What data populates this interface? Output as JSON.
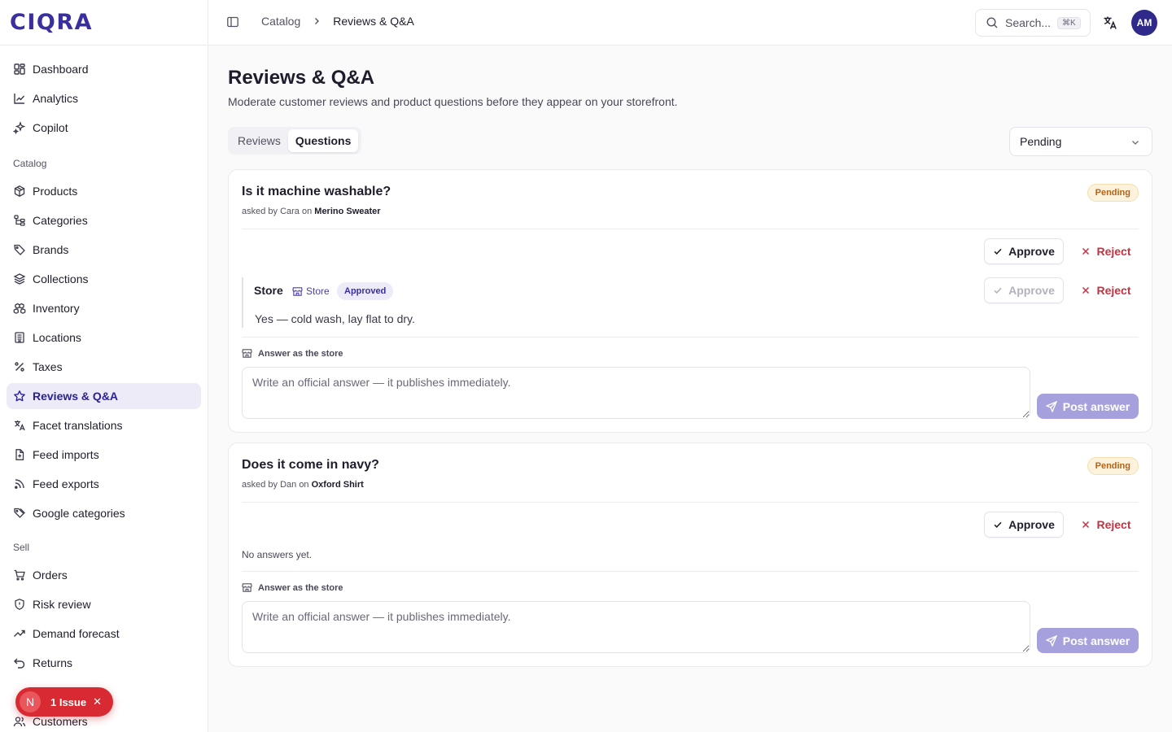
{
  "brand": {
    "logo_text": "CIQRA"
  },
  "sidebar": {
    "top_items": [
      {
        "label": "Dashboard",
        "icon": "dashboard-icon"
      },
      {
        "label": "Analytics",
        "icon": "analytics-icon"
      },
      {
        "label": "Copilot",
        "icon": "sparkles-icon"
      }
    ],
    "catalog_group": "Catalog",
    "catalog_items": [
      {
        "label": "Products",
        "icon": "package-icon"
      },
      {
        "label": "Categories",
        "icon": "tree-icon"
      },
      {
        "label": "Brands",
        "icon": "tag-icon"
      },
      {
        "label": "Collections",
        "icon": "layers-icon"
      },
      {
        "label": "Inventory",
        "icon": "boxes-icon"
      },
      {
        "label": "Locations",
        "icon": "building-icon"
      },
      {
        "label": "Taxes",
        "icon": "percent-icon"
      },
      {
        "label": "Reviews & Q&A",
        "icon": "star-icon",
        "active": true
      },
      {
        "label": "Facet translations",
        "icon": "translate-icon"
      },
      {
        "label": "Feed imports",
        "icon": "file-import-icon"
      },
      {
        "label": "Feed exports",
        "icon": "rss-icon"
      },
      {
        "label": "Google categories",
        "icon": "tags-icon"
      }
    ],
    "sell_group": "Sell",
    "sell_items": [
      {
        "label": "Orders",
        "icon": "cart-icon"
      },
      {
        "label": "Risk review",
        "icon": "shield-icon"
      },
      {
        "label": "Demand forecast",
        "icon": "trending-icon"
      },
      {
        "label": "Returns",
        "icon": "undo-icon"
      },
      {
        "label": "",
        "icon": "hidden-icon"
      },
      {
        "label": "Customers",
        "icon": "users-icon"
      }
    ],
    "issue_pill": {
      "initial": "N",
      "label": "1 Issue",
      "close": "✕"
    }
  },
  "topbar": {
    "breadcrumb": [
      "Catalog",
      "Reviews & Q&A"
    ],
    "search_placeholder": "Search...",
    "search_shortcut": "⌘K",
    "avatar_initials": "AM"
  },
  "page": {
    "title": "Reviews & Q&A",
    "subtitle": "Moderate customer reviews and product questions before they appear on your storefront.",
    "tabs": [
      {
        "label": "Reviews",
        "active": false
      },
      {
        "label": "Questions",
        "active": true
      }
    ],
    "status_filter": "Pending"
  },
  "questions": [
    {
      "title": "Is it machine washable?",
      "asked_prefix": "asked by Cara on",
      "product": "Merino Sweater",
      "status": "Pending",
      "approve_label": "Approve",
      "reject_label": "Reject",
      "answers": [
        {
          "author": "Store",
          "source": "Store",
          "status": "Approved",
          "text": "Yes — cold wash, lay flat to dry.",
          "approve_label": "Approve",
          "reject_label": "Reject"
        }
      ],
      "answer_label": "Answer as the store",
      "answer_placeholder": "Write an official answer — it publishes immediately.",
      "post_label": "Post answer"
    },
    {
      "title": "Does it come in navy?",
      "asked_prefix": "asked by Dan on",
      "product": "Oxford Shirt",
      "status": "Pending",
      "approve_label": "Approve",
      "reject_label": "Reject",
      "no_answers": "No answers yet.",
      "answer_label": "Answer as the store",
      "answer_placeholder": "Write an official answer — it publishes immediately.",
      "post_label": "Post answer"
    }
  ]
}
